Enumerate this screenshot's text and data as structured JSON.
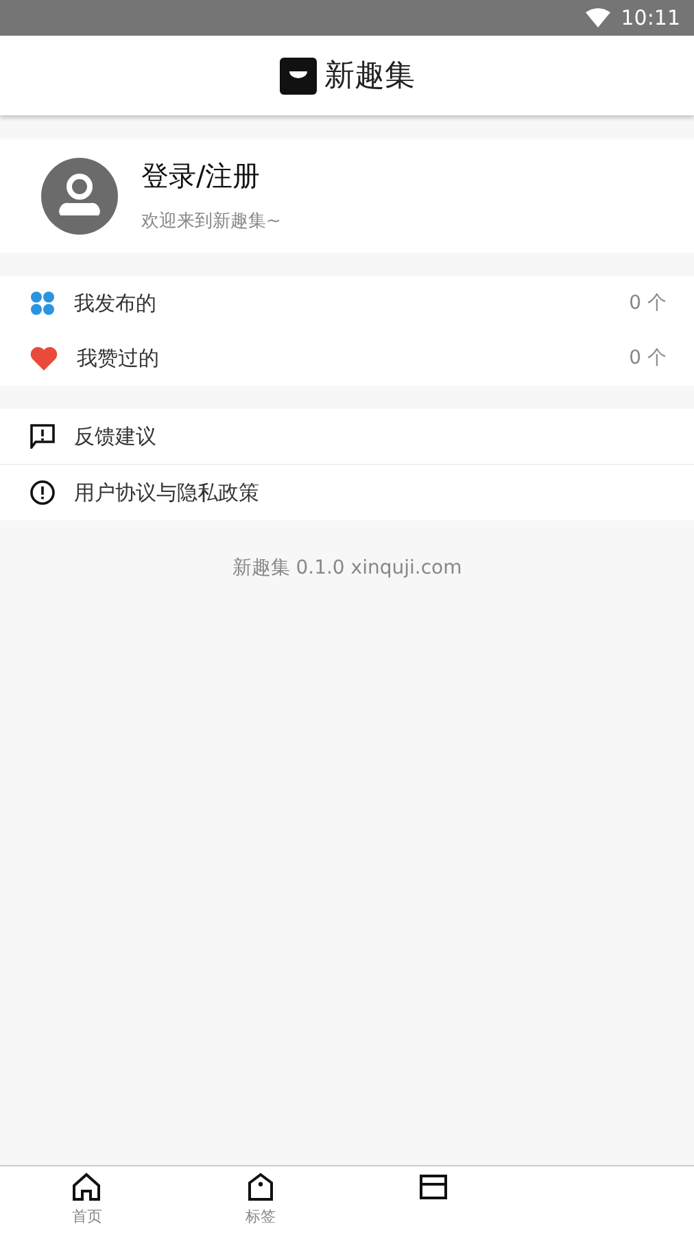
{
  "status_bar": {
    "time": "10:11"
  },
  "header": {
    "title": "新趣集"
  },
  "profile": {
    "name": "登录/注册",
    "subtitle": "欢迎来到新趣集~"
  },
  "stats": [
    {
      "kind": "grid",
      "label": "我发布的",
      "count": "0 个"
    },
    {
      "kind": "heart",
      "label": "我赞过的",
      "count": "0 个"
    }
  ],
  "links": [
    {
      "kind": "feedback",
      "label": "反馈建议"
    },
    {
      "kind": "info",
      "label": "用户协议与隐私政策"
    }
  ],
  "footer": "新趣集 0.1.0 xinquji.com",
  "nav": [
    {
      "kind": "home",
      "label": "首页"
    },
    {
      "kind": "tag",
      "label": "标签"
    },
    {
      "kind": "card"
    },
    {
      "kind": "none"
    }
  ]
}
